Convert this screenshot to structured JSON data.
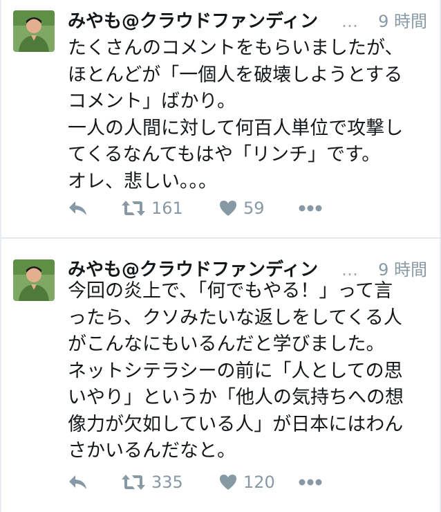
{
  "tweets": [
    {
      "author": "みやも@クラウドファンディン",
      "ellipsis": "…",
      "time": "9 時間",
      "lines": [
        "たくさんのコメントをもらいましたが、",
        "ほとんどが「一個人を破壊しようとする",
        "コメント」ばかり。",
        "一人の人間に対して何百人単位で攻撃し",
        "てくるなんてもはや「リンチ」です。",
        "オレ、悲しい。。。"
      ],
      "retweets": "161",
      "likes": "59"
    },
    {
      "author": "みやも@クラウドファンディン",
      "ellipsis": "…",
      "time": "9 時間",
      "lines": [
        "今回の炎上で、「何でもやる！」って言",
        "ったら、クソみたいな返しをしてくる人",
        "がこんなにもいるんだと学びました。",
        "ネットシテラシーの前に「人としての思",
        "いやり」というか「他人の気持ちへの想",
        "像力が欠如している人」が日本にはわん",
        "さかいるんだなと。"
      ],
      "retweets": "335",
      "likes": "120"
    }
  ],
  "icons": {
    "reply": "reply-icon",
    "retweet": "retweet-icon",
    "like": "heart-icon",
    "more": "more-dots-icon"
  },
  "colors": {
    "text": "#14171a",
    "muted": "#8899a6",
    "separator": "#e1e8ed",
    "avatar_bg": "#6f9a55",
    "shirt": "#4e7a3a"
  }
}
